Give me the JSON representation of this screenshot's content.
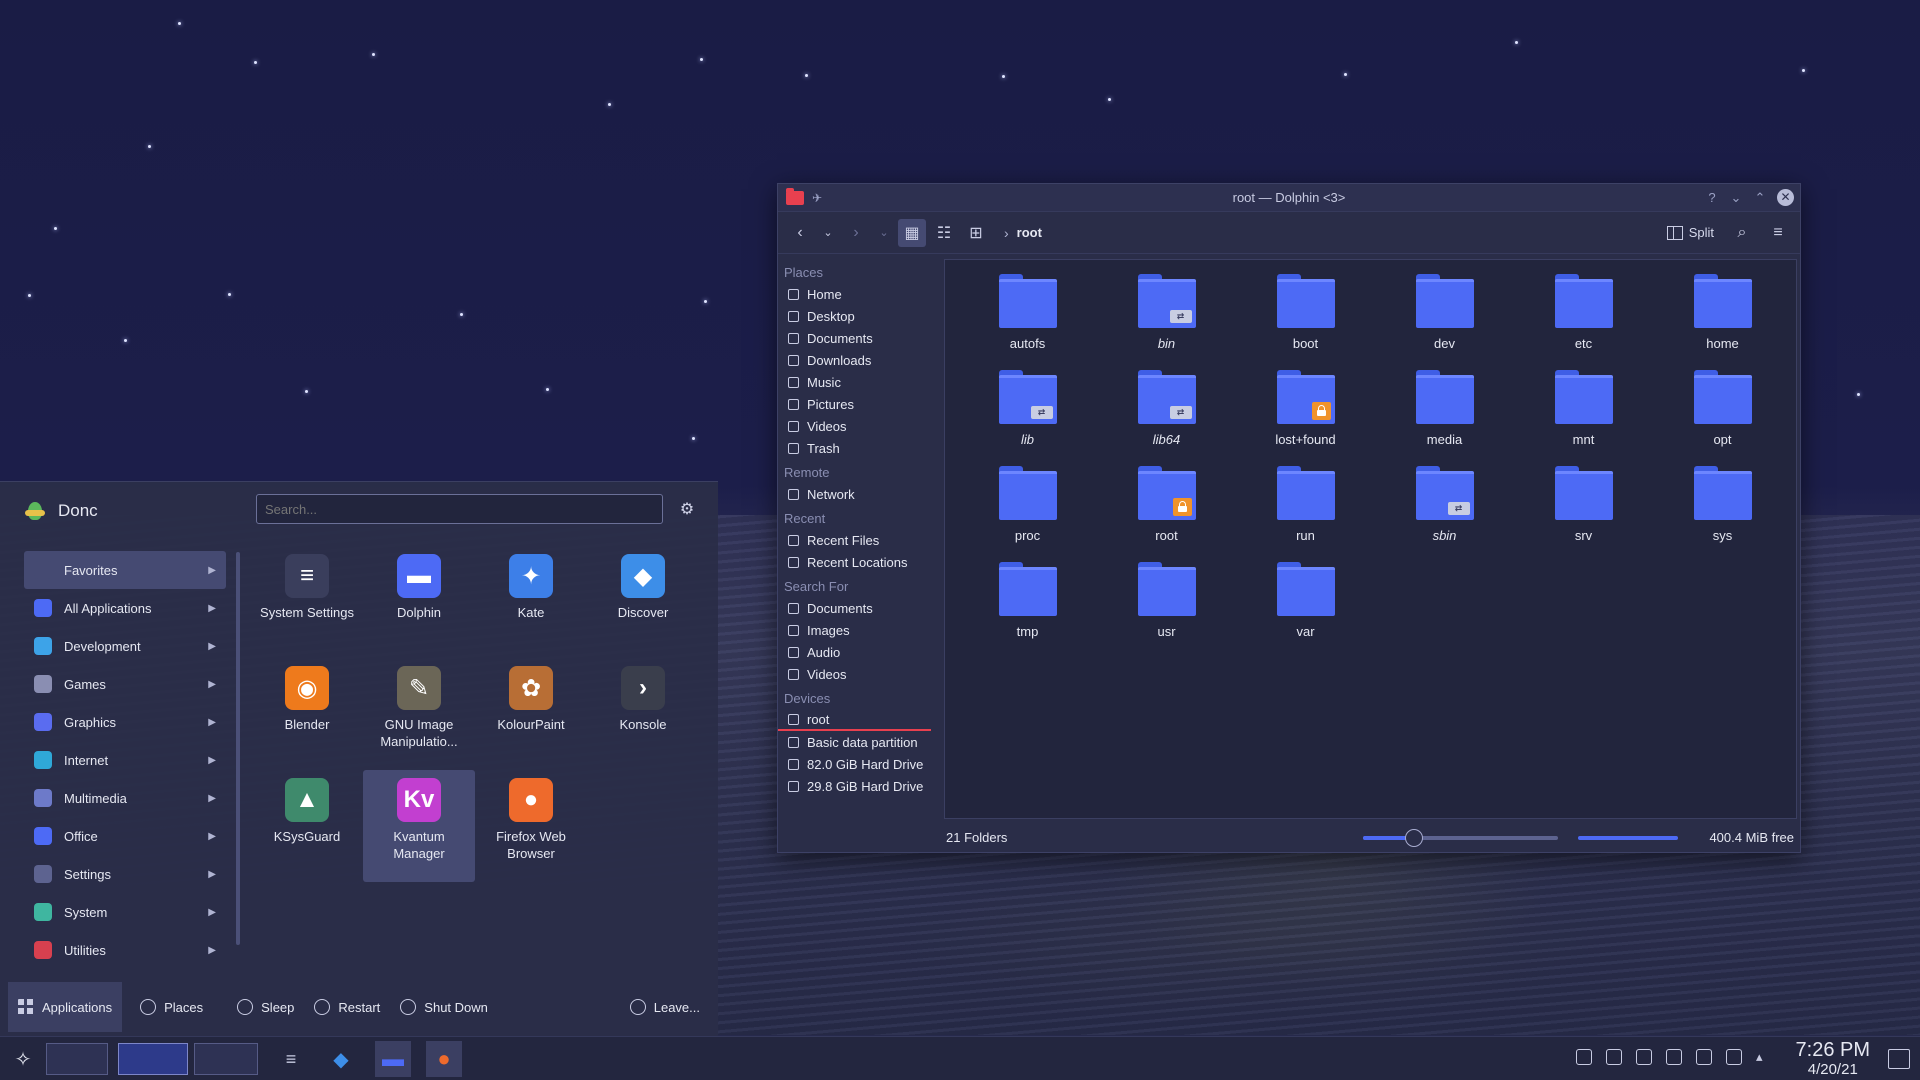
{
  "dolphin": {
    "title": "root — Dolphin <3>",
    "breadcrumb": "root",
    "split_label": "Split",
    "places": [
      {
        "heading": "Places",
        "items": [
          "Home",
          "Desktop",
          "Documents",
          "Downloads",
          "Music",
          "Pictures",
          "Videos",
          "Trash"
        ]
      },
      {
        "heading": "Remote",
        "items": [
          "Network"
        ]
      },
      {
        "heading": "Recent",
        "items": [
          "Recent Files",
          "Recent Locations"
        ]
      },
      {
        "heading": "Search For",
        "items": [
          "Documents",
          "Images",
          "Audio",
          "Videos"
        ]
      },
      {
        "heading": "Devices",
        "items": [
          "root",
          "Basic data partition",
          "82.0 GiB Hard Drive",
          "29.8 GiB Hard Drive"
        ]
      }
    ],
    "folders": [
      {
        "name": "autofs",
        "emblem": ""
      },
      {
        "name": "bin",
        "emblem": "link"
      },
      {
        "name": "boot",
        "emblem": ""
      },
      {
        "name": "dev",
        "emblem": ""
      },
      {
        "name": "etc",
        "emblem": ""
      },
      {
        "name": "home",
        "emblem": ""
      },
      {
        "name": "lib",
        "emblem": "link"
      },
      {
        "name": "lib64",
        "emblem": "link"
      },
      {
        "name": "lost+found",
        "emblem": "lock"
      },
      {
        "name": "media",
        "emblem": ""
      },
      {
        "name": "mnt",
        "emblem": ""
      },
      {
        "name": "opt",
        "emblem": ""
      },
      {
        "name": "proc",
        "emblem": ""
      },
      {
        "name": "root",
        "emblem": "lock"
      },
      {
        "name": "run",
        "emblem": ""
      },
      {
        "name": "sbin",
        "emblem": "link"
      },
      {
        "name": "srv",
        "emblem": ""
      },
      {
        "name": "sys",
        "emblem": ""
      },
      {
        "name": "tmp",
        "emblem": ""
      },
      {
        "name": "usr",
        "emblem": ""
      },
      {
        "name": "var",
        "emblem": ""
      }
    ],
    "status": {
      "count": "21 Folders",
      "free": "400.4 MiB free"
    }
  },
  "launcher": {
    "user": "Donc",
    "search_placeholder": "Search...",
    "categories": [
      {
        "label": "Favorites",
        "color": "#454a72"
      },
      {
        "label": "All Applications",
        "color": "#4d6af5"
      },
      {
        "label": "Development",
        "color": "#3da3e8"
      },
      {
        "label": "Games",
        "color": "#8a8eb2"
      },
      {
        "label": "Graphics",
        "color": "#5a6cf0"
      },
      {
        "label": "Internet",
        "color": "#2fa8d8"
      },
      {
        "label": "Multimedia",
        "color": "#6d7ac9"
      },
      {
        "label": "Office",
        "color": "#4d6af5"
      },
      {
        "label": "Settings",
        "color": "#5d6390"
      },
      {
        "label": "System",
        "color": "#3fb6a0"
      },
      {
        "label": "Utilities",
        "color": "#d8404f"
      }
    ],
    "apps": [
      {
        "name": "System Settings",
        "glyph": "≡",
        "color": "#3a3e5c"
      },
      {
        "name": "Dolphin",
        "glyph": "▬",
        "color": "#4d6af5"
      },
      {
        "name": "Kate",
        "glyph": "✦",
        "color": "#3d7fe8"
      },
      {
        "name": "Discover",
        "glyph": "◆",
        "color": "#3d8ee8"
      },
      {
        "name": "Blender",
        "glyph": "◉",
        "color": "#ee7a1c"
      },
      {
        "name": "GNU Image Manipulatio...",
        "glyph": "✎",
        "color": "#6b6657"
      },
      {
        "name": "KolourPaint",
        "glyph": "✿",
        "color": "#b86e35"
      },
      {
        "name": "Konsole",
        "glyph": "›",
        "color": "#3a3e4c"
      },
      {
        "name": "KSysGuard",
        "glyph": "▲",
        "color": "#3f8a6c"
      },
      {
        "name": "Kvantum Manager",
        "glyph": "Kv",
        "color": "#c23fd0"
      },
      {
        "name": "Firefox Web Browser",
        "glyph": "●",
        "color": "#ee6a2c"
      }
    ],
    "footer": {
      "applications": "Applications",
      "places": "Places",
      "sleep": "Sleep",
      "restart": "Restart",
      "shutdown": "Shut Down",
      "leave": "Leave..."
    }
  },
  "taskbar": {
    "time": "7:26 PM",
    "date": "4/20/21"
  }
}
